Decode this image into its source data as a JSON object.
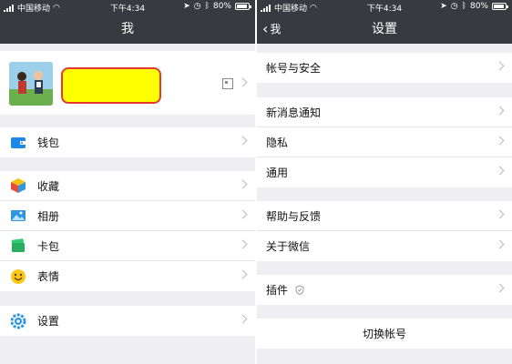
{
  "status": {
    "carrier": "中国移动",
    "time": "下午4:34",
    "battery": "80%",
    "battery_level": 0.8
  },
  "left": {
    "title": "我",
    "groups": [
      {
        "items": [
          {
            "label": "钱包",
            "icon": "wallet-icon"
          }
        ]
      },
      {
        "items": [
          {
            "label": "收藏",
            "icon": "favorites-icon"
          },
          {
            "label": "相册",
            "icon": "album-icon"
          },
          {
            "label": "卡包",
            "icon": "card-wallet-icon"
          },
          {
            "label": "表情",
            "icon": "emoji-icon"
          }
        ]
      },
      {
        "items": [
          {
            "label": "设置",
            "icon": "settings-icon"
          }
        ]
      }
    ]
  },
  "right": {
    "back_label": "我",
    "title": "设置",
    "groups": [
      {
        "items": [
          {
            "label": "帐号与安全"
          }
        ]
      },
      {
        "items": [
          {
            "label": "新消息通知"
          },
          {
            "label": "隐私"
          },
          {
            "label": "通用"
          }
        ]
      },
      {
        "items": [
          {
            "label": "帮助与反馈"
          },
          {
            "label": "关于微信"
          }
        ]
      },
      {
        "items": [
          {
            "label": "插件",
            "icon": "shield-icon"
          }
        ]
      }
    ],
    "switch_account": "切换帐号"
  },
  "colors": {
    "topbar": "#393a3f",
    "background": "#eeeef3",
    "redaction": "#ffff00",
    "redaction_border": "#e23b2e"
  }
}
